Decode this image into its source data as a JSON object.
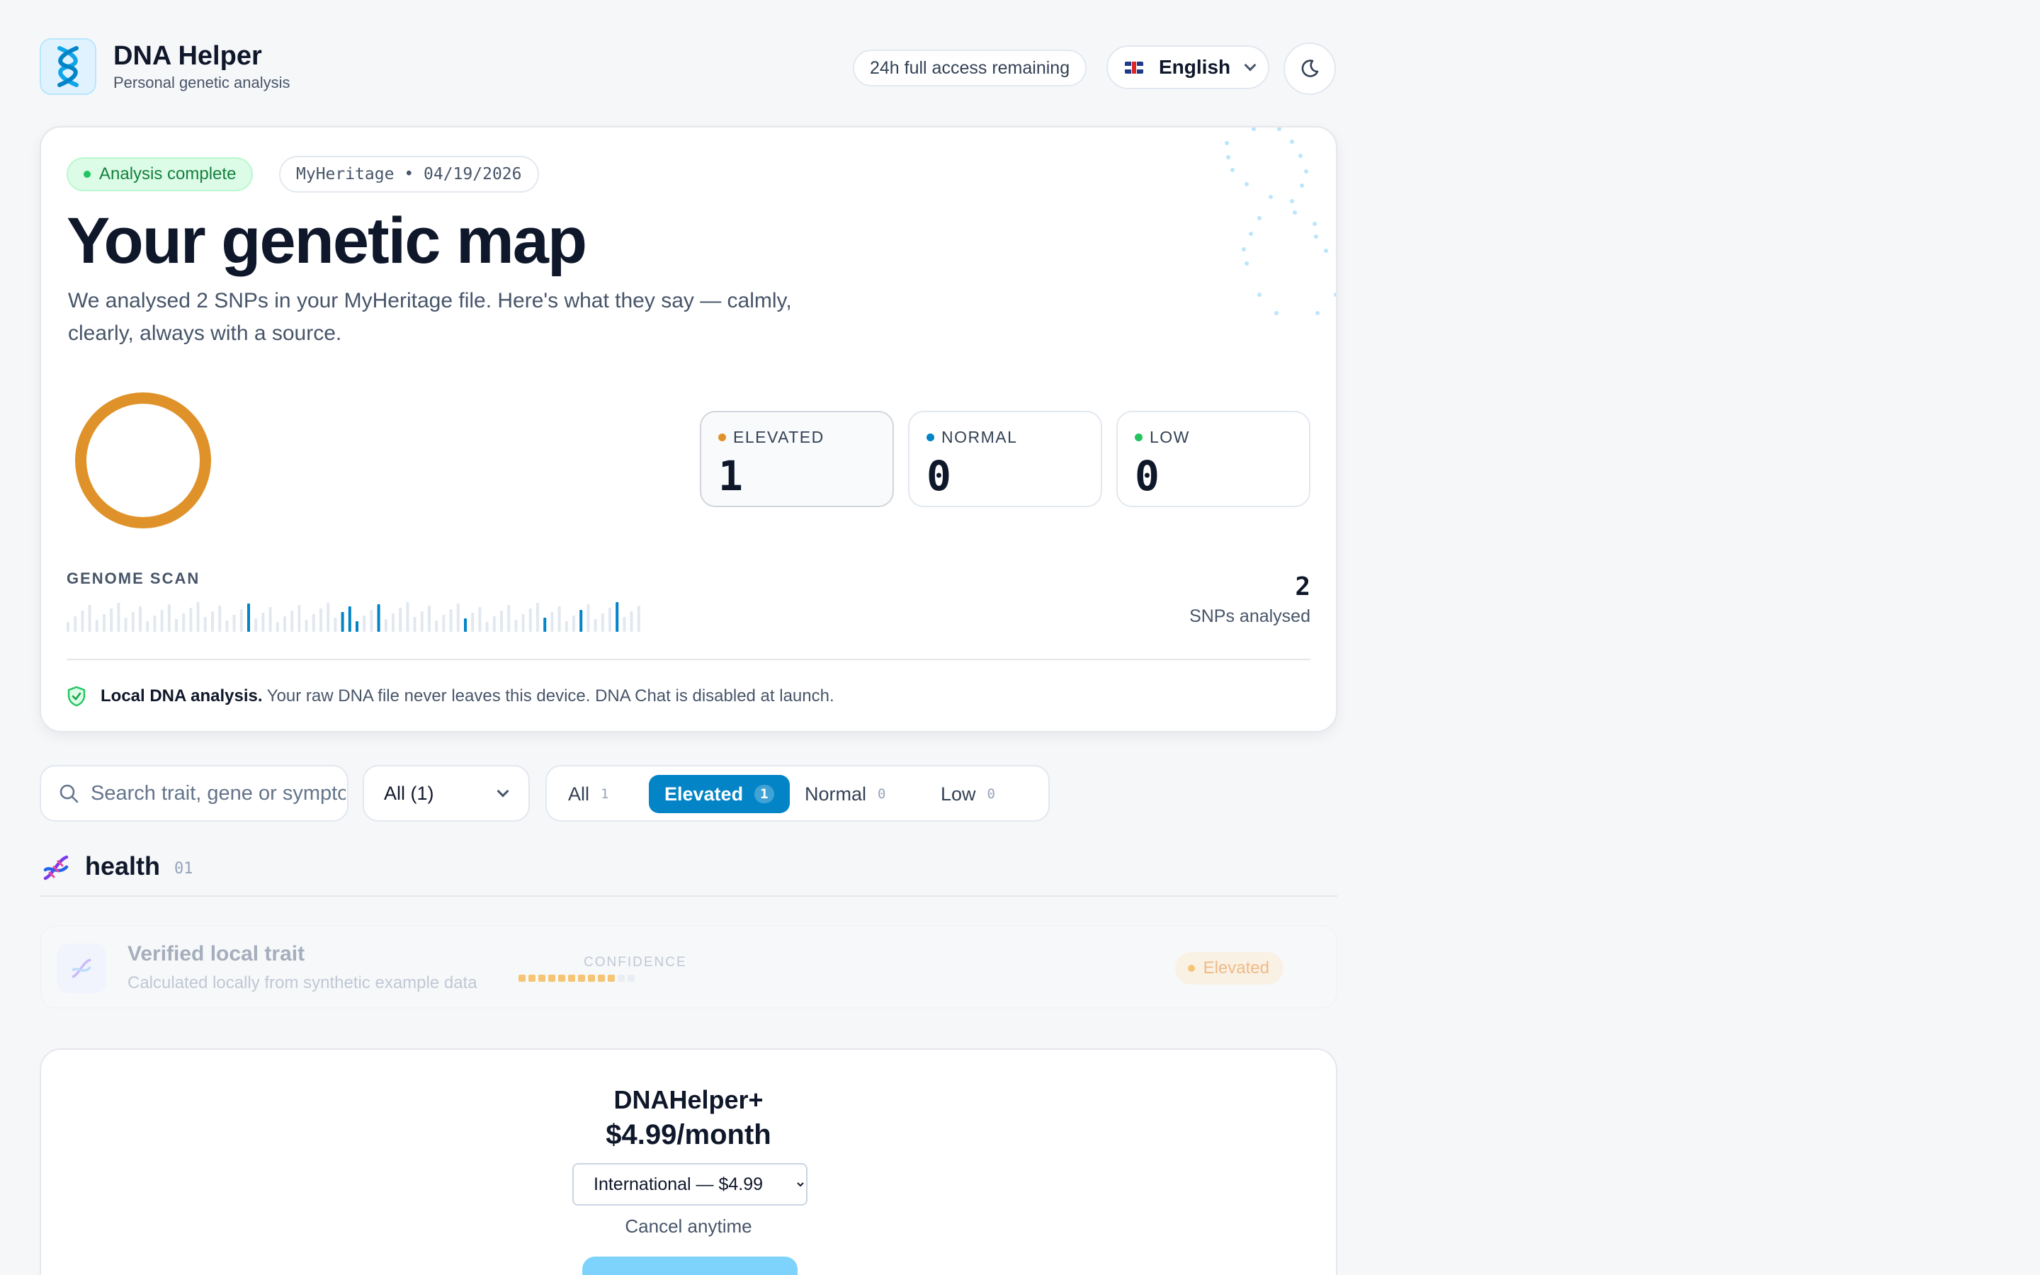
{
  "app": {
    "name": "DNA Helper",
    "subtitle": "Personal genetic analysis",
    "access_pill": "24h full access remaining",
    "language": "English"
  },
  "hero": {
    "status_badge": "Analysis complete",
    "source_badge": "MyHeritage • 04/19/2026",
    "title": "Your genetic map",
    "description": "We analysed 2 SNPs in your MyHeritage file. Here's what they say — calmly, clearly, always with a source.",
    "stats": [
      {
        "label": "ELEVATED",
        "value": "1",
        "color": "#e0922a"
      },
      {
        "label": "NORMAL",
        "value": "0",
        "color": "#0284c7"
      },
      {
        "label": "LOW",
        "value": "0",
        "color": "#22c55e"
      }
    ],
    "genome_scan_label": "GENOME SCAN",
    "snp_count": "2",
    "snp_count_label": "SNPs analysed",
    "local_note_bold": "Local DNA analysis.",
    "local_note_text": "Your raw DNA file never leaves this device. DNA Chat is disabled at launch."
  },
  "filters": {
    "search_placeholder": "Search trait, gene or symptom",
    "category_select": "All (1)",
    "segments": [
      {
        "label": "All",
        "count": "1"
      },
      {
        "label": "Elevated",
        "count": "1",
        "active": true
      },
      {
        "label": "Normal",
        "count": "0"
      },
      {
        "label": "Low",
        "count": "0"
      }
    ]
  },
  "section": {
    "title": "health",
    "count": "01"
  },
  "trait": {
    "title": "Verified local trait",
    "subtitle": "Calculated locally from synthetic example data",
    "confidence_label": "CONFIDENCE",
    "confidence_fraction": 0.8,
    "badge": "Elevated"
  },
  "pricing": {
    "plan_name": "DNAHelper+",
    "price": "$4.99/month",
    "region_select": "International — $4.99",
    "note": "Cancel anytime"
  },
  "colors": {
    "accent": "#0284c7",
    "elevated": "#e0922a",
    "success": "#22c55e"
  }
}
